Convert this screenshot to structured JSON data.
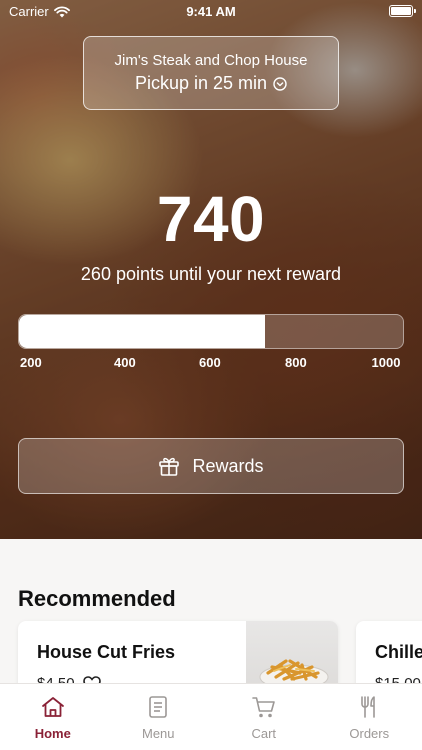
{
  "status_bar": {
    "carrier": "Carrier",
    "time": "9:41 AM"
  },
  "location": {
    "name": "Jim's Steak and Chop House",
    "pickup": "Pickup in 25 min"
  },
  "rewards": {
    "points": "740",
    "subtitle": "260 points until your next reward",
    "progress_fraction": 0.64,
    "scale_labels": [
      "200",
      "400",
      "600",
      "800",
      "1000"
    ],
    "button_label": "Rewards"
  },
  "recommended": {
    "title": "Recommended",
    "items": [
      {
        "name": "House Cut Fries",
        "price": "$4.50"
      },
      {
        "name": "Chilled",
        "price": "$15.00"
      }
    ]
  },
  "tabs": [
    {
      "label": "Home",
      "icon": "home-icon",
      "active": true
    },
    {
      "label": "Menu",
      "icon": "menu-icon",
      "active": false
    },
    {
      "label": "Cart",
      "icon": "cart-icon",
      "active": false
    },
    {
      "label": "Orders",
      "icon": "utensils-icon",
      "active": false
    }
  ],
  "colors": {
    "accent": "#8a2136",
    "tab_inactive": "#9c9896"
  }
}
